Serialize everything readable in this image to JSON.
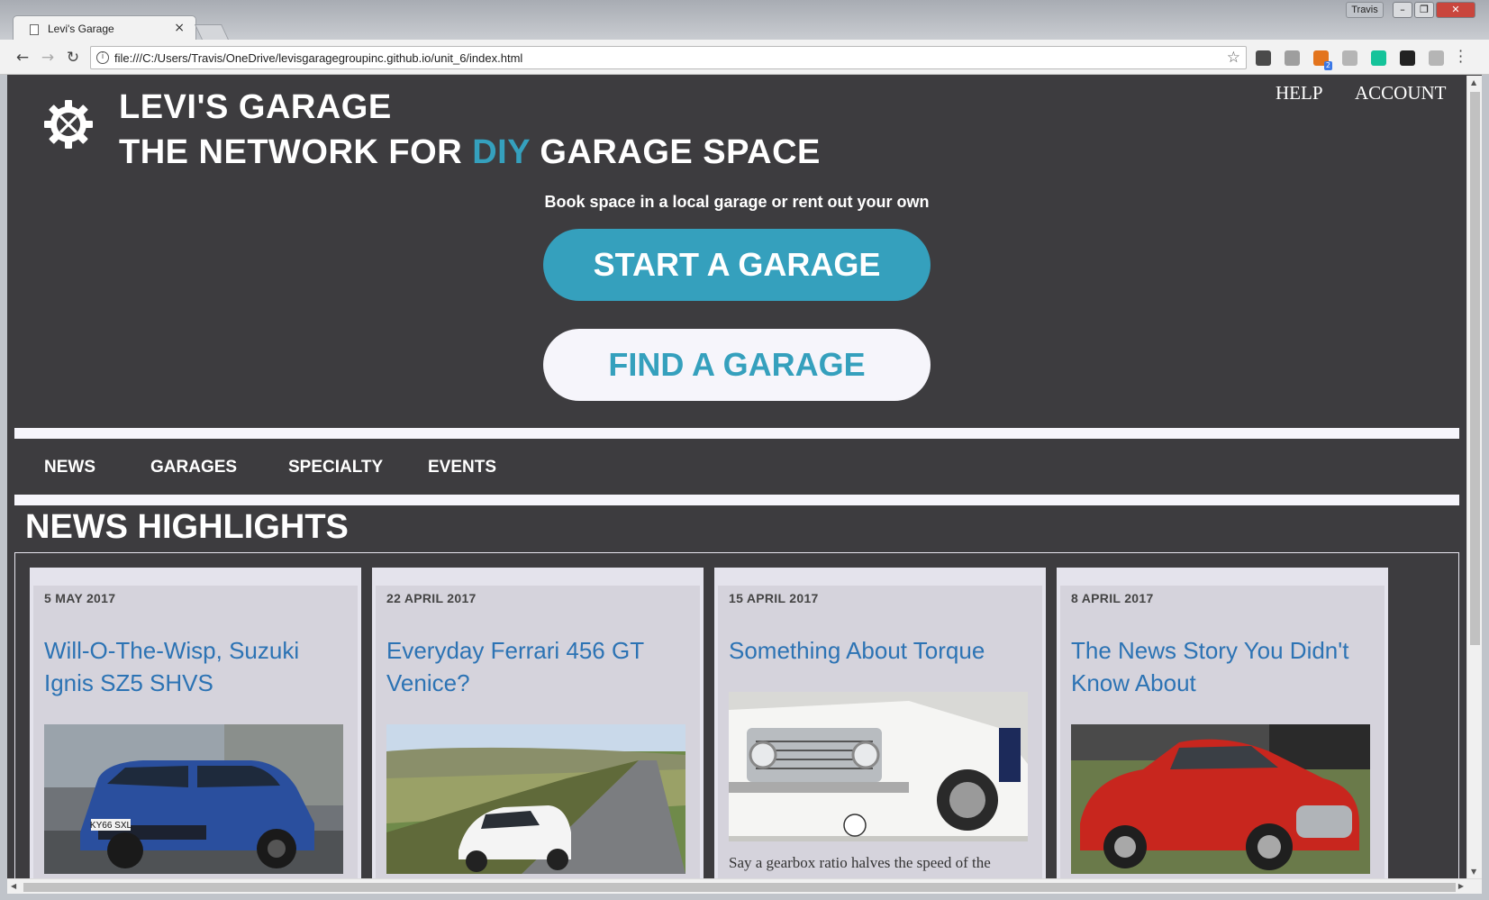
{
  "browser": {
    "tab_title": "Levi's Garage",
    "tab_close": "×",
    "user_name": "Travis",
    "url": "file:///C:/Users/Travis/OneDrive/levisgaragegroupinc.github.io/unit_6/index.html",
    "window_controls": [
      "–",
      "❐",
      "✕"
    ],
    "extensions": [
      {
        "name": "evernote-icon",
        "color": "#4a4a4a"
      },
      {
        "name": "drive-icon",
        "color": "#9e9e9e"
      },
      {
        "name": "feed-icon",
        "color": "#e3741d",
        "badge": "2"
      },
      {
        "name": "circle-icon",
        "color": "#b5b5b5"
      },
      {
        "name": "grammarly-icon",
        "color": "#15c39a"
      },
      {
        "name": "contrast-icon",
        "color": "#222222"
      },
      {
        "name": "pdf-icon",
        "color": "#b5b5b5"
      }
    ]
  },
  "header": {
    "brand_line1": "LEVI'S GARAGE",
    "brand_line2_pre": "THE NETWORK FOR ",
    "brand_line2_accent": "DIY",
    "brand_line2_post": " GARAGE SPACE",
    "help_link": "HELP",
    "account_link": "ACCOUNT"
  },
  "hero": {
    "tagline": "Book space in a local garage or rent out your own",
    "start_button": "START A GARAGE",
    "find_button": "FIND A GARAGE"
  },
  "nav": {
    "items": [
      "NEWS",
      "GARAGES",
      "SPECIALTY",
      "EVENTS"
    ]
  },
  "news": {
    "section_title": "NEWS HIGHLIGHTS",
    "cards": [
      {
        "date": "5 MAY 2017",
        "title": "Will-O-The-Wisp, Suzuki Ignis SZ5 SHVS",
        "image": "blue-suzuki-photo",
        "plate": "KY66 SXL",
        "excerpt": ""
      },
      {
        "date": "22 APRIL 2017",
        "title": "Everyday Ferrari 456 GT Venice?",
        "image": "white-ferrari-photo",
        "excerpt": ""
      },
      {
        "date": "15 APRIL 2017",
        "title": "Something About Torque",
        "image": "white-classic-car-photo",
        "excerpt": "Say a gearbox ratio halves the speed of the"
      },
      {
        "date": "8 APRIL 2017",
        "title": "The News Story You Didn't Know About",
        "image": "red-classic-car-photo",
        "excerpt": ""
      }
    ]
  },
  "colors": {
    "background": "#3d3c3f",
    "accent": "#35a0bd",
    "link": "#2c73b4",
    "card": "#e4e3ec",
    "light": "#f6f5fb"
  }
}
